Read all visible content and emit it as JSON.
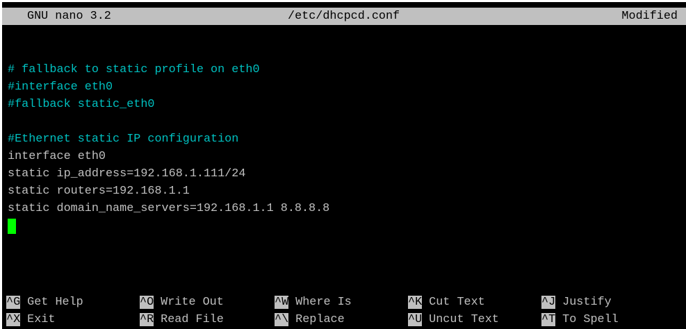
{
  "titlebar": {
    "app": "GNU nano 3.2",
    "file": "/etc/dhcpcd.conf",
    "status": "Modified"
  },
  "editor": {
    "lines": [
      {
        "text": "",
        "kind": "plain"
      },
      {
        "text": "# fallback to static profile on eth0",
        "kind": "comment"
      },
      {
        "text": "#interface eth0",
        "kind": "comment"
      },
      {
        "text": "#fallback static_eth0",
        "kind": "comment"
      },
      {
        "text": "",
        "kind": "plain"
      },
      {
        "text": "#Ethernet static IP configuration",
        "kind": "comment"
      },
      {
        "text": "interface eth0",
        "kind": "plain"
      },
      {
        "text": "static ip_address=192.168.1.111/24",
        "kind": "plain"
      },
      {
        "text": "static routers=192.168.1.1",
        "kind": "plain"
      },
      {
        "text": "static domain_name_servers=192.168.1.1 8.8.8.8",
        "kind": "plain"
      }
    ]
  },
  "shortcuts": {
    "row1": [
      {
        "key": "^G",
        "label": "Get Help"
      },
      {
        "key": "^O",
        "label": "Write Out"
      },
      {
        "key": "^W",
        "label": "Where Is"
      },
      {
        "key": "^K",
        "label": "Cut Text"
      },
      {
        "key": "^J",
        "label": "Justify"
      }
    ],
    "row2": [
      {
        "key": "^X",
        "label": "Exit"
      },
      {
        "key": "^R",
        "label": "Read File"
      },
      {
        "key": "^\\",
        "label": "Replace"
      },
      {
        "key": "^U",
        "label": "Uncut Text"
      },
      {
        "key": "^T",
        "label": "To Spell"
      }
    ]
  },
  "colors": {
    "background": "#000000",
    "text": "#c0c0c0",
    "comment": "#00c0c0",
    "cursor": "#00ff00",
    "bar": "#c0c0c0"
  }
}
